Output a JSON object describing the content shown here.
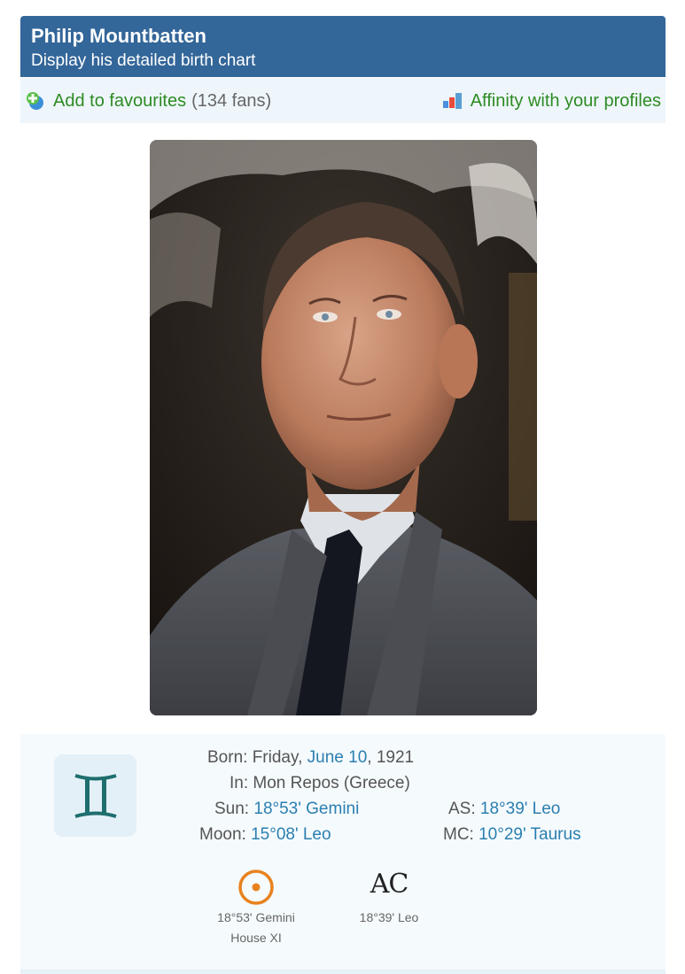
{
  "header": {
    "name": "Philip Mountbatten",
    "subtitle": "Display his detailed birth chart",
    "background_color": "#336699"
  },
  "actions": {
    "favourites_label": "Add to favourites",
    "favourites_count": "(134 fans)",
    "affinity_label": "Affinity with your profiles",
    "link_color": "#2e8b23"
  },
  "photo": {
    "icon": "portrait-photo"
  },
  "birth": {
    "born_label": "Born:",
    "born_day": "Friday,",
    "born_date": "June 10",
    "born_year": ", 1921",
    "in_label": "In:",
    "in_value": "Mon Repos (Greece)",
    "sun_label": "Sun:",
    "sun_value": "18°53' Gemini",
    "moon_label": "Moon:",
    "moon_value": "15°08' Leo",
    "as_label": "AS:",
    "as_value": "18°39' Leo",
    "mc_label": "MC:",
    "mc_value": "10°29' Taurus",
    "sign_icon": "gemini-icon",
    "sign_color": "#1e6e6e"
  },
  "planets": [
    {
      "glyph": "sun-icon",
      "position": "18°53' Gemini",
      "house": "House XI",
      "color": "#e8821e"
    },
    {
      "glyph": "AC",
      "position": "18°39' Leo",
      "house": ""
    }
  ]
}
